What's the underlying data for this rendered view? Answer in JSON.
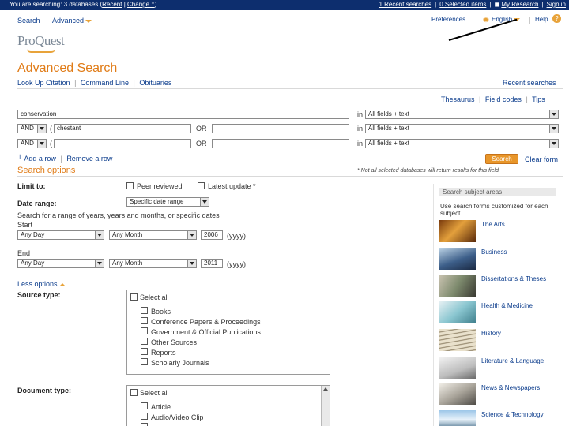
{
  "topbar": {
    "searching_prefix": "You are searching: 3 databases (",
    "databases_link": "Recent",
    "sep1": "|",
    "change_link": "Change ::",
    "searching_suffix": ")",
    "recent_searches": "1 Recent searches",
    "selected_items": "0 Selected items",
    "my_research": "My Research",
    "sign_in": "Sign in"
  },
  "nav": {
    "search": "Search",
    "advanced": "Advanced",
    "preferences": "Preferences",
    "language": "English",
    "help": "Help"
  },
  "logo": "ProQuest",
  "page": {
    "title": "Advanced Search",
    "links": [
      "Look Up Citation",
      "Command Line",
      "Obituaries"
    ],
    "recent_searches": "Recent searches",
    "thesaurus": "Thesaurus",
    "field_codes": "Field codes",
    "tips": "Tips"
  },
  "rows": [
    {
      "op": "",
      "paren": "",
      "term": "conservation",
      "or_term": "",
      "field": "All fields + text"
    },
    {
      "op": "AND",
      "paren": "(",
      "term": "chestant",
      "or_term": "",
      "field": "All fields + text"
    },
    {
      "op": "AND",
      "paren": "(",
      "term": "",
      "or_term": "",
      "field": "All fields + text"
    }
  ],
  "labels": {
    "in": "in",
    "or": "OR",
    "add_row": "Add a row",
    "remove_row": "Remove a row",
    "search_btn": "Search",
    "clear_form": "Clear form",
    "search_options": "Search options",
    "note": "* Not all selected databases will return results for this field",
    "limit_to": "Limit to:",
    "peer_reviewed": "Peer reviewed",
    "latest_update": "Latest update *",
    "date_range": "Date range:",
    "date_range_value": "Specific date range",
    "date_hint": "Search for a range of years, years and months, or specific dates",
    "start": "Start",
    "end": "End",
    "day": "Any Day",
    "month": "Any Month",
    "start_year": "2006",
    "end_year": "2011",
    "yyyy": "(yyyy)",
    "less_options": "Less options",
    "source_type": "Source type:",
    "document_type": "Document type:",
    "select_all": "Select all"
  },
  "source_types": [
    "Books",
    "Conference Papers & Proceedings",
    "Government & Official Publications",
    "Other Sources",
    "Reports",
    "Scholarly Journals"
  ],
  "document_types": [
    "Article",
    "Audio/Video Clip",
    "..."
  ],
  "subject_panel": {
    "header": "Search subject areas",
    "intro": "Use search forms customized for each subject.",
    "subjects": [
      "The Arts",
      "Business",
      "Dissertations & Theses",
      "Health & Medicine",
      "History",
      "Literature & Language",
      "News & Newspapers",
      "Science & Technology"
    ]
  },
  "colors": {
    "topbar": "#0d2e6e",
    "accent": "#e07c18",
    "link": "#0b3c8c"
  }
}
